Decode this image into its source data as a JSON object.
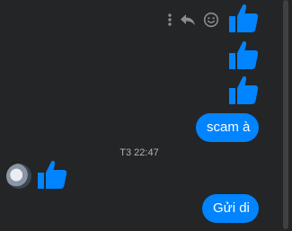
{
  "colors": {
    "background": "#242526",
    "accent": "#0084ff",
    "bubble_text": "#ffffff",
    "muted_text": "#b0b3b8",
    "icon_gray": "#8a8d91"
  },
  "message_actions": {
    "icons": [
      "more-icon",
      "reply-icon",
      "react-icon"
    ]
  },
  "messages": {
    "outgoing_1": "scam à",
    "timestamp": "T3 22:47",
    "outgoing_2": "Gửi di"
  }
}
